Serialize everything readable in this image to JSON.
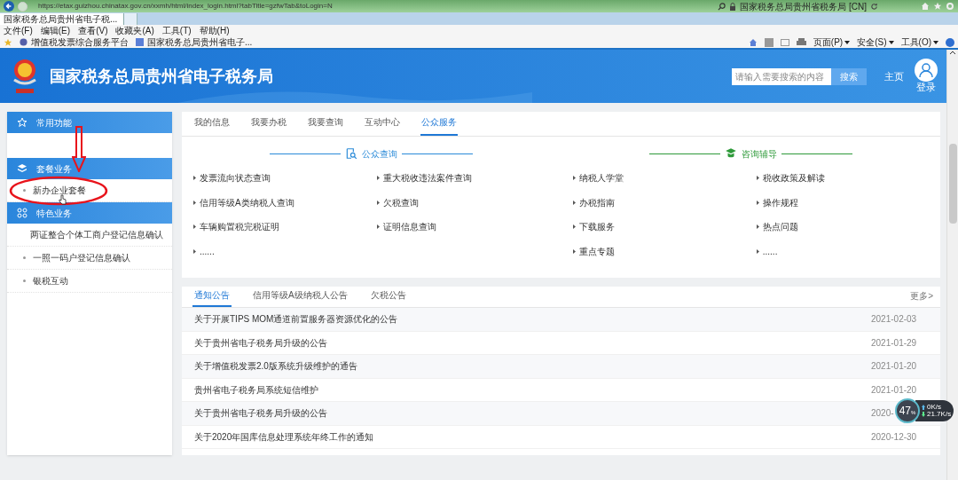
{
  "browser": {
    "address": "https://etax.guizhou.chinatax.gov.cn/xxmh/html/index_login.html?tabTitle=gzfwTab&toLogin=N",
    "site_identity": "国家税务总局贵州省税务局 [CN]",
    "tabs": [
      {
        "label": "国家税务总局贵州省电子税...",
        "selected": true
      }
    ],
    "menu": [
      "文件(F)",
      "编辑(E)",
      "查看(V)",
      "收藏夹(A)",
      "工具(T)",
      "帮助(H)"
    ],
    "favorites": [
      {
        "label": "增值税发票综合服务平台",
        "kind": "globe"
      },
      {
        "label": "国家税务总局贵州省电子...",
        "kind": "page"
      }
    ],
    "commands": [
      "页面(P)",
      "安全(S)",
      "工具(O)"
    ]
  },
  "header": {
    "title": "国家税务总局贵州省电子税务局",
    "search": {
      "placeholder": "请输入需要搜索的内容",
      "button": "搜索"
    },
    "home": "主页",
    "login": "登录"
  },
  "sidebar": [
    {
      "title": "常用功能",
      "kind": "star"
    },
    {
      "title": "套餐业务",
      "kind": "layers",
      "items": [
        {
          "label": "新办企业套餐",
          "highlighted": true
        }
      ]
    },
    {
      "title": "特色业务",
      "kind": "grid",
      "items": [
        {
          "label": "两证整合个体工商户登记信息确认",
          "highlighted": false
        },
        {
          "label": "一照一码户登记信息确认",
          "highlighted": false
        },
        {
          "label": "银税互动",
          "highlighted": false
        }
      ]
    }
  ],
  "service_tabs": [
    {
      "label": "我的信息",
      "selected": false
    },
    {
      "label": "我要办税",
      "selected": false
    },
    {
      "label": "我要查询",
      "selected": false
    },
    {
      "label": "互动中心",
      "selected": false
    },
    {
      "label": "公众服务",
      "selected": true
    }
  ],
  "service_groups": [
    {
      "title": "公众查询",
      "color": "#2a8ad8",
      "kind": "query",
      "columns": [
        [
          "发票流向状态查询",
          "信用等级A类纳税人查询",
          "车辆购置税完税证明",
          "......"
        ],
        [
          "重大税收违法案件查询",
          "欠税查询",
          "证明信息查询"
        ]
      ]
    },
    {
      "title": "咨询辅导",
      "color": "#2e9a3a",
      "kind": "consult",
      "columns": [
        [
          "纳税人学堂",
          "办税指南",
          "下载服务",
          "重点专题"
        ],
        [
          "税收政策及解读",
          "操作规程",
          "热点问题",
          "......"
        ]
      ]
    }
  ],
  "notices": {
    "tabs": [
      {
        "label": "通知公告",
        "selected": true
      },
      {
        "label": "信用等级A级纳税人公告",
        "selected": false
      },
      {
        "label": "欠税公告",
        "selected": false
      }
    ],
    "more": "更多>",
    "rows": [
      {
        "title": "关于开展TIPS MOM通道前置服务器资源优化的公告",
        "date": "2021-02-03"
      },
      {
        "title": "关于贵州省电子税务局升级的公告",
        "date": "2021-01-29"
      },
      {
        "title": "关于增值税发票2.0版系统升级维护的通告",
        "date": "2021-01-20"
      },
      {
        "title": "贵州省电子税务局系统短信维护",
        "date": "2021-01-20"
      },
      {
        "title": "关于贵州省电子税务局升级的公告",
        "date": "2020-"
      },
      {
        "title": "关于2020年国库信息处理系统年终工作的通知",
        "date": "2020-12-30"
      }
    ]
  },
  "net_widget": {
    "percent": "47",
    "unit": "%",
    "upload": "0K/s",
    "download": "21.7K/s"
  }
}
